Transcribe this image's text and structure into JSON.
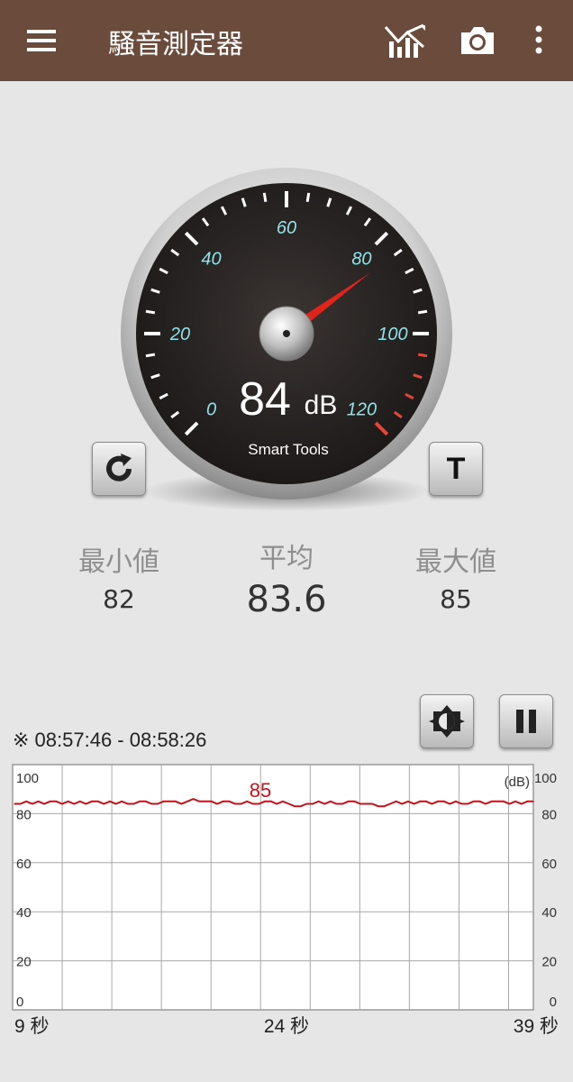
{
  "appbar": {
    "title": "騒音測定器",
    "menu_icon": "hamburger-menu-icon",
    "chart_icon": "chart-icon",
    "camera_icon": "camera-icon",
    "more_icon": "more-vert-icon"
  },
  "gauge": {
    "value": 84,
    "unit": "dB",
    "brand": "Smart Tools",
    "scale_labels": [
      "0",
      "20",
      "40",
      "60",
      "80",
      "100",
      "120"
    ],
    "scale_min": 0,
    "scale_max": 120
  },
  "controls": {
    "reset_icon": "refresh-icon",
    "calibrate_label": "T",
    "brightness_icon": "brightness-icon",
    "pause_icon": "pause-icon"
  },
  "stats": {
    "min_label": "最小値",
    "min_value": "82",
    "avg_label": "平均",
    "avg_value": "83.6",
    "max_label": "最大値",
    "max_value": "85"
  },
  "graph": {
    "range": "※ 08:57:46 - 08:58:26",
    "unit": "(dB)",
    "peak_label": "85",
    "y_ticks": [
      "100",
      "80",
      "60",
      "40",
      "20",
      "0"
    ],
    "x_start": "9 秒",
    "x_mid": "24 秒",
    "x_end": "39 秒"
  },
  "chart_data": {
    "type": "line",
    "xlabel": "",
    "ylabel": "",
    "ylim": [
      0,
      100
    ],
    "grid": true,
    "series": [
      {
        "values": [
          84,
          84,
          85,
          84,
          85,
          84,
          85,
          85,
          84,
          85,
          84,
          85,
          84,
          85,
          85,
          84,
          85,
          84,
          85,
          84,
          84,
          85,
          85,
          84,
          84,
          85,
          85,
          85,
          84,
          85,
          86,
          85,
          85,
          85,
          84,
          85,
          85,
          84,
          84,
          85,
          84,
          84,
          85,
          85,
          84,
          85,
          84,
          83,
          83,
          84,
          84,
          85,
          84,
          85,
          84,
          84,
          85,
          85,
          84,
          84,
          84,
          83,
          83,
          84,
          85,
          84,
          85,
          84,
          85,
          85,
          84,
          85,
          85,
          84,
          85,
          84,
          84,
          85,
          85,
          84,
          85,
          85,
          85,
          84,
          85,
          84,
          85,
          85
        ]
      }
    ]
  }
}
